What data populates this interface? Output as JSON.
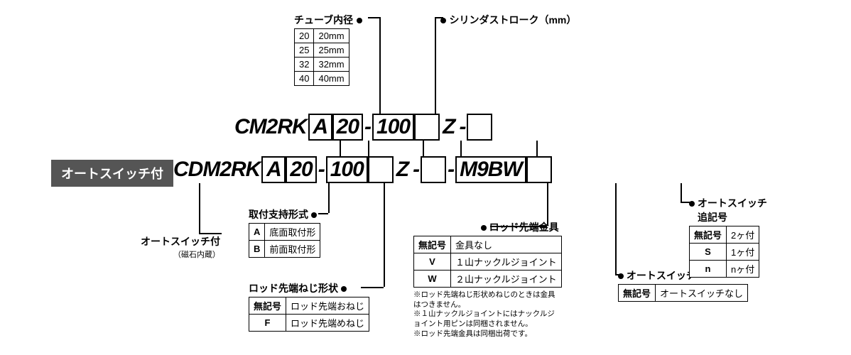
{
  "badge": "オートスイッチ付",
  "row1": {
    "prefix": "CM2RK",
    "s1": "A",
    "s2": "20",
    "s3": "100",
    "z": "Z"
  },
  "row2": {
    "prefix": "CDM2RK",
    "s1": "A",
    "s2": "20",
    "s3": "100",
    "z": "Z",
    "sw": "M9BW"
  },
  "sections": {
    "tube": {
      "title": "チューブ内径",
      "rows": [
        [
          "20",
          "20mm"
        ],
        [
          "25",
          "25mm"
        ],
        [
          "32",
          "32mm"
        ],
        [
          "40",
          "40mm"
        ]
      ]
    },
    "stroke_title": "シリンダストローク（mm）",
    "mount": {
      "title": "取付支持形式",
      "rows": [
        [
          "A",
          "底面取付形"
        ],
        [
          "B",
          "前面取付形"
        ]
      ]
    },
    "autoswitch_with": {
      "title": "オートスイッチ付",
      "sub": "（磁石内蔵）"
    },
    "rod_thread": {
      "title": "ロッド先端ねじ形状",
      "rows": [
        [
          "無記号",
          "ロッド先端おねじ"
        ],
        [
          "F",
          "ロッド先端めねじ"
        ]
      ]
    },
    "rod_end": {
      "title": "ロッド先端金具",
      "rows": [
        [
          "無記号",
          "金具なし"
        ],
        [
          "V",
          "１山ナックルジョイント"
        ],
        [
          "W",
          "２山ナックルジョイント"
        ]
      ],
      "notes": [
        "※ロッド先端ねじ形状めねじのときは金具はつきません。",
        "※１山ナックルジョイントにはナックルジョイント用ピンは同梱されません。",
        "※ロッド先端金具は同梱出荷です。"
      ]
    },
    "autoswitch": {
      "title": "オートスイッチ",
      "rows": [
        [
          "無記号",
          "オートスイッチなし"
        ]
      ]
    },
    "autoswitch_suffix": {
      "title1": "オートスイッチ",
      "title2": "追記号",
      "rows": [
        [
          "無記号",
          "2ヶ付"
        ],
        [
          "S",
          "1ヶ付"
        ],
        [
          "n",
          "nヶ付"
        ]
      ]
    }
  }
}
